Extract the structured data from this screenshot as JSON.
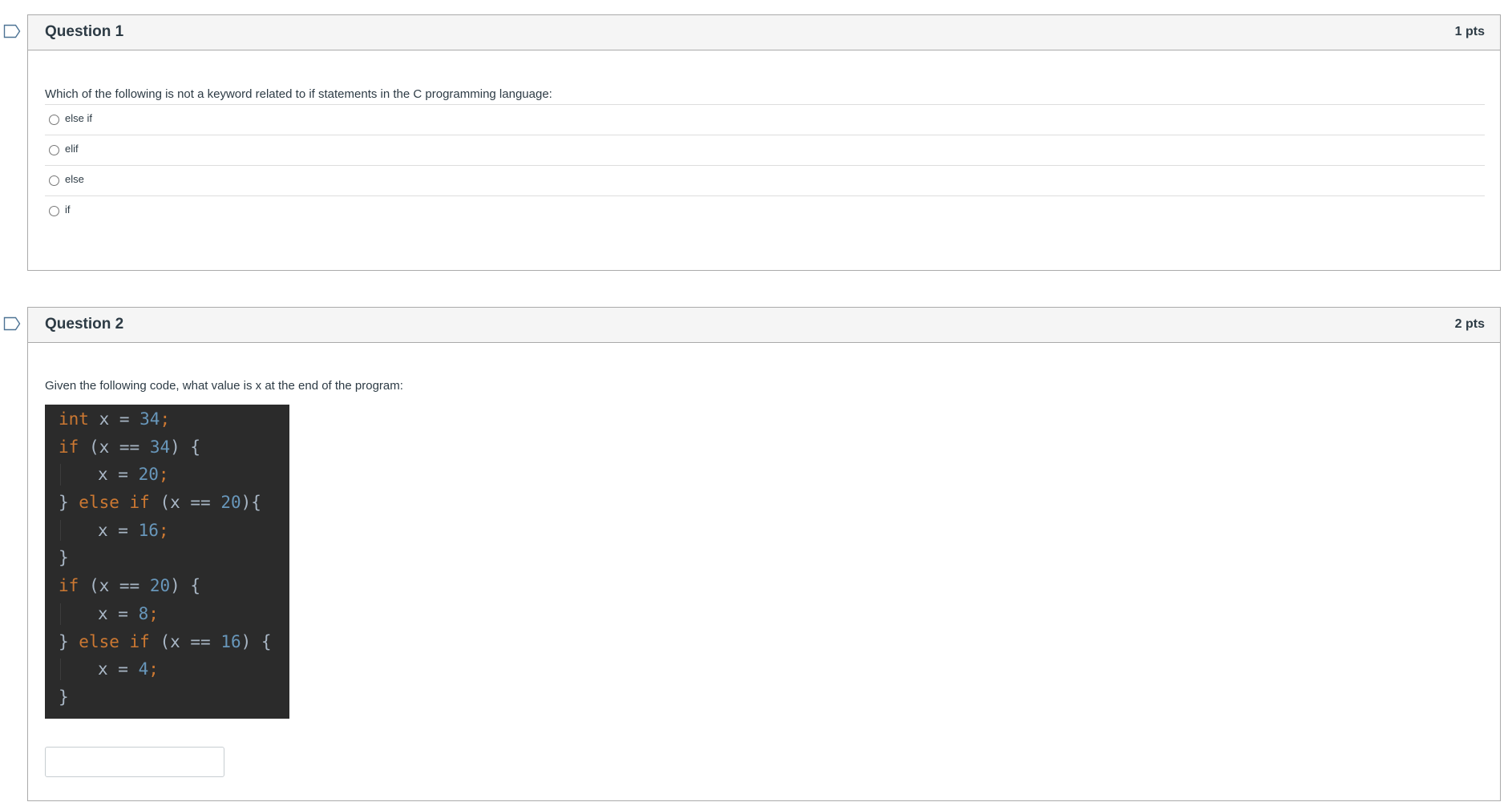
{
  "colors": {
    "flag_outline": "#4d7394",
    "header_bg": "#f5f5f5",
    "border": "#aaaaaa",
    "code_bg": "#2b2b2b",
    "code_keyword": "#cc7832",
    "code_number": "#6897bb",
    "code_text": "#a9b7c6"
  },
  "questions": [
    {
      "title": "Question 1",
      "points": "1 pts",
      "flag_icon": "flag-outline-icon",
      "prompt": "Which of the following is not a keyword related to if statements in the C programming language:",
      "type": "multiple_choice",
      "options": [
        {
          "label": "else if",
          "selected": false
        },
        {
          "label": "elif",
          "selected": false
        },
        {
          "label": "else",
          "selected": false
        },
        {
          "label": "if",
          "selected": false
        }
      ]
    },
    {
      "title": "Question 2",
      "points": "2 pts",
      "flag_icon": "flag-outline-icon",
      "prompt": "Given the following code, what value is x at the end of the program:",
      "type": "short_answer",
      "code_lines": [
        {
          "indent": false,
          "tokens": [
            {
              "t": "kw",
              "v": "int"
            },
            {
              "t": "tx",
              "v": " x = "
            },
            {
              "t": "num",
              "v": "34"
            },
            {
              "t": "semi",
              "v": ";"
            }
          ]
        },
        {
          "indent": false,
          "tokens": [
            {
              "t": "kw",
              "v": "if"
            },
            {
              "t": "tx",
              "v": " (x == "
            },
            {
              "t": "num",
              "v": "34"
            },
            {
              "t": "tx",
              "v": ") {"
            }
          ]
        },
        {
          "indent": true,
          "tokens": [
            {
              "t": "tx",
              "v": "x = "
            },
            {
              "t": "num",
              "v": "20"
            },
            {
              "t": "semi",
              "v": ";"
            }
          ]
        },
        {
          "indent": false,
          "tokens": [
            {
              "t": "tx",
              "v": "} "
            },
            {
              "t": "kw",
              "v": "else if"
            },
            {
              "t": "tx",
              "v": " (x == "
            },
            {
              "t": "num",
              "v": "20"
            },
            {
              "t": "tx",
              "v": "){"
            }
          ]
        },
        {
          "indent": true,
          "tokens": [
            {
              "t": "tx",
              "v": "x = "
            },
            {
              "t": "num",
              "v": "16"
            },
            {
              "t": "semi",
              "v": ";"
            }
          ]
        },
        {
          "indent": false,
          "tokens": [
            {
              "t": "tx",
              "v": "}"
            }
          ]
        },
        {
          "indent": false,
          "tokens": [
            {
              "t": "kw",
              "v": "if"
            },
            {
              "t": "tx",
              "v": " (x == "
            },
            {
              "t": "num",
              "v": "20"
            },
            {
              "t": "tx",
              "v": ") {"
            }
          ]
        },
        {
          "indent": true,
          "tokens": [
            {
              "t": "tx",
              "v": "x = "
            },
            {
              "t": "num",
              "v": "8"
            },
            {
              "t": "semi",
              "v": ";"
            }
          ]
        },
        {
          "indent": false,
          "tokens": [
            {
              "t": "tx",
              "v": "} "
            },
            {
              "t": "kw",
              "v": "else if"
            },
            {
              "t": "tx",
              "v": " (x == "
            },
            {
              "t": "num",
              "v": "16"
            },
            {
              "t": "tx",
              "v": ") {"
            }
          ]
        },
        {
          "indent": true,
          "tokens": [
            {
              "t": "tx",
              "v": "x = "
            },
            {
              "t": "num",
              "v": "4"
            },
            {
              "t": "semi",
              "v": ";"
            }
          ]
        },
        {
          "indent": false,
          "tokens": [
            {
              "t": "tx",
              "v": "}"
            }
          ]
        }
      ],
      "answer_value": "",
      "answer_placeholder": ""
    }
  ]
}
